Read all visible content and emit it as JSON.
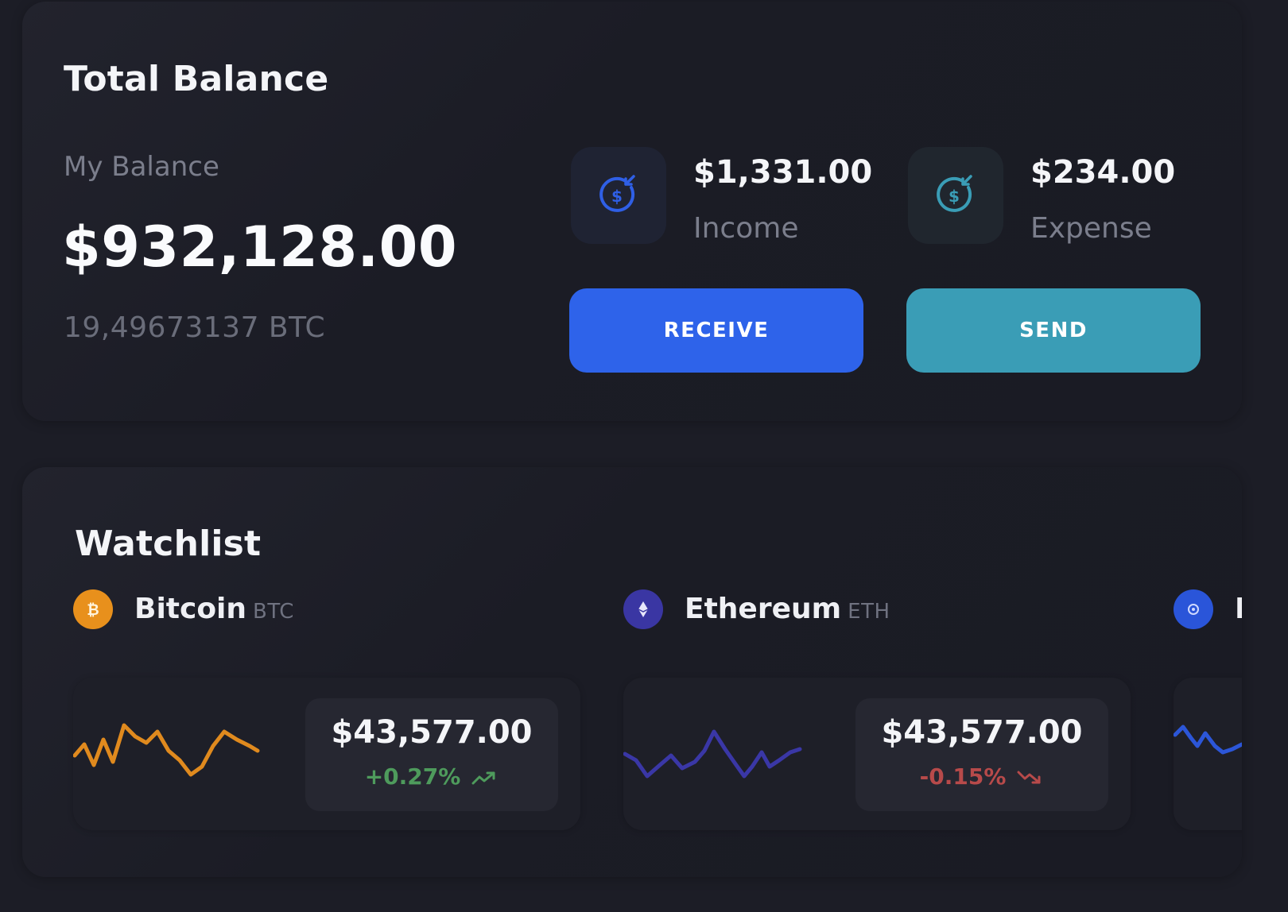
{
  "balance_card": {
    "title": "Total Balance",
    "my_balance_label": "My Balance",
    "amount": "$932,128.00",
    "btc_amount": "19,49673137 BTC",
    "income": {
      "value": "$1,331.00",
      "label": "Income",
      "icon": "dollar-refresh-icon"
    },
    "expense": {
      "value": "$234.00",
      "label": "Expense",
      "icon": "dollar-refresh-icon"
    },
    "receive_label": "RECEIVE",
    "send_label": "SEND"
  },
  "watchlist": {
    "title": "Watchlist",
    "coins": [
      {
        "name": "Bitcoin",
        "symbol": "BTC",
        "icon": "bitcoin-icon",
        "price": "$43,577.00",
        "change": "+0.27%",
        "trend": "up",
        "line_color": "#e08a1e",
        "change_color": "#4e9b5c"
      },
      {
        "name": "Ethereum",
        "symbol": "ETH",
        "icon": "ethereum-icon",
        "price": "$43,577.00",
        "change": "-0.15%",
        "trend": "down",
        "line_color": "#3a37a6",
        "change_color": "#b74a4a"
      },
      {
        "name": "E",
        "icon": "coin-icon",
        "line_color": "#2c56d8"
      }
    ]
  },
  "colors": {
    "background": "#1c1d26",
    "receive_button": "#2e63ea",
    "send_button": "#3a9db6",
    "bitcoin_badge": "#e8901c",
    "ethereum_badge": "#3a36a3",
    "third_coin_badge": "#2a55d9"
  }
}
